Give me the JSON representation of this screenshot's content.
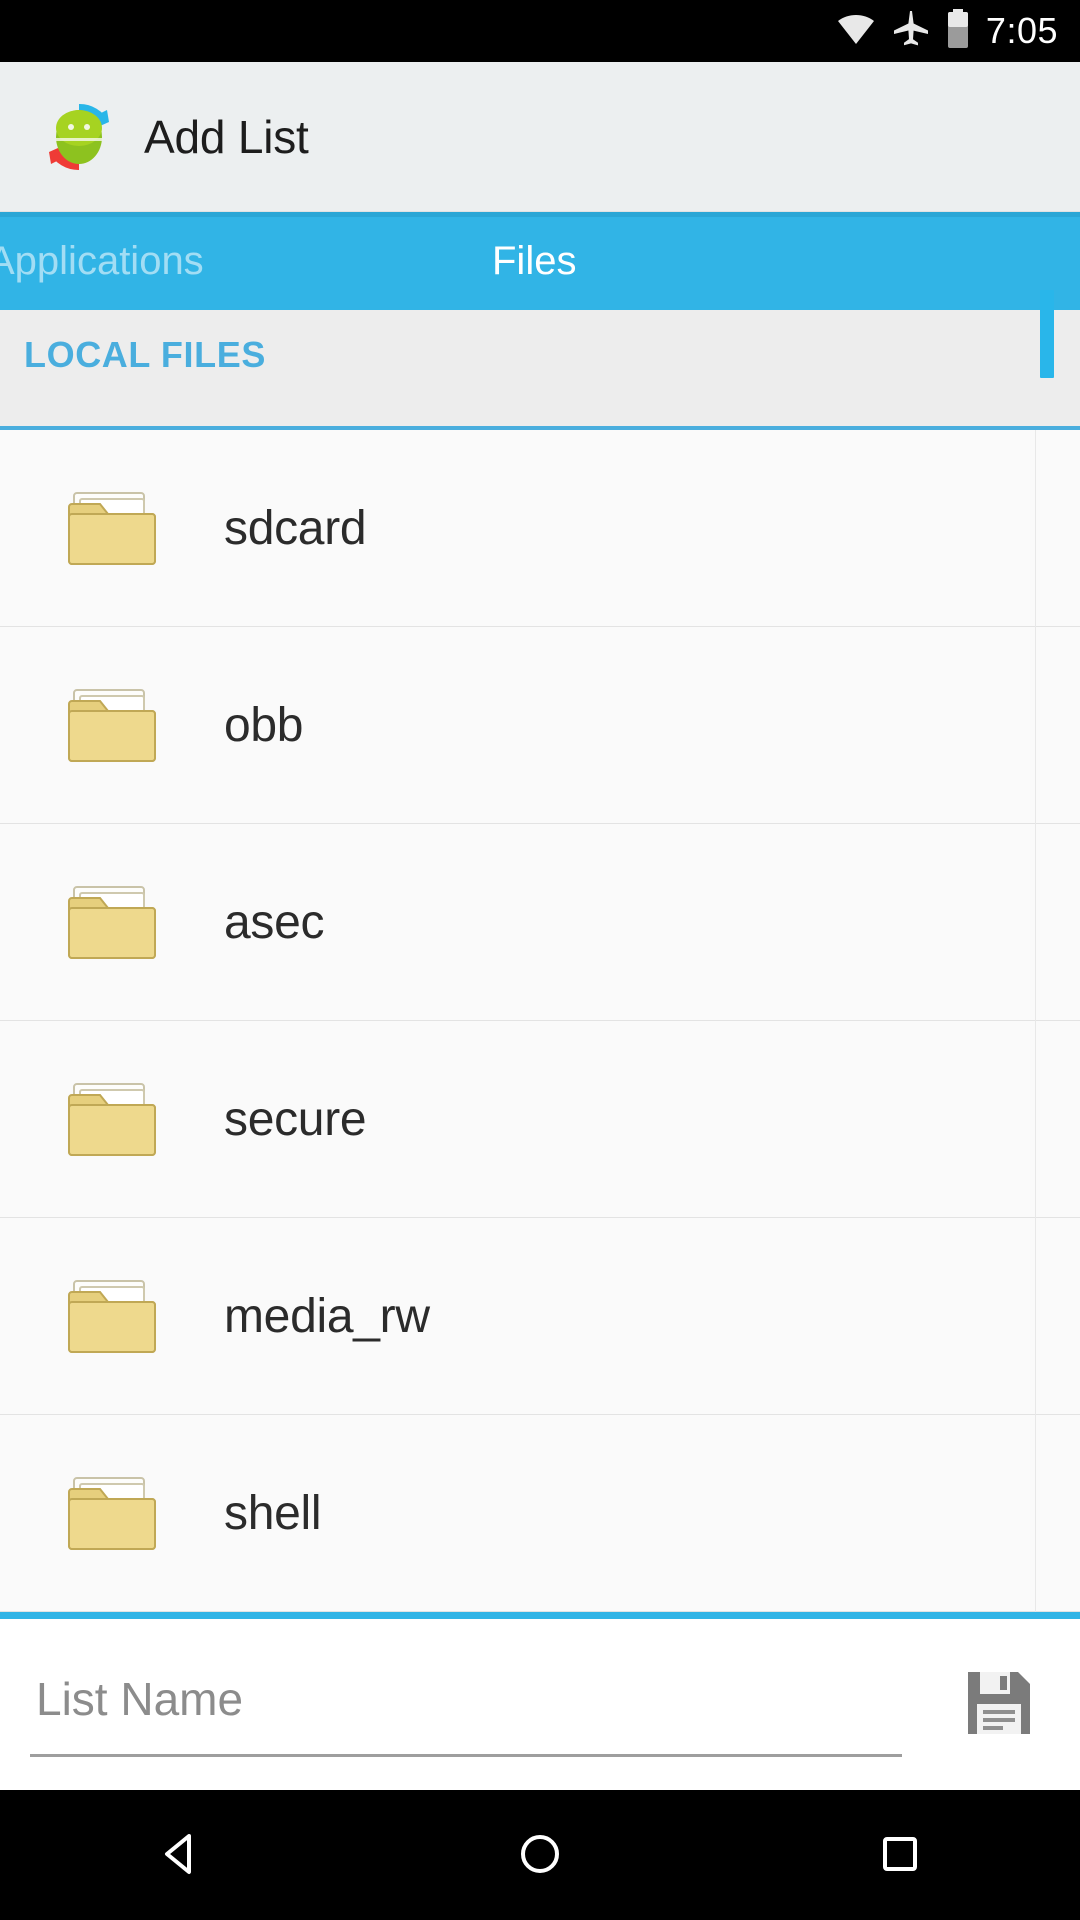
{
  "status_bar": {
    "time": "7:05",
    "icons": [
      "wifi-icon",
      "airplane-mode-icon",
      "battery-icon"
    ]
  },
  "app_bar": {
    "title": "Add List",
    "logo": "android-sync-logo-icon"
  },
  "tabs": [
    {
      "label": "Applications",
      "active": false
    },
    {
      "label": "Files",
      "active": true
    }
  ],
  "section": {
    "header": "LOCAL FILES"
  },
  "files": [
    {
      "name": "sdcard",
      "icon": "folder-icon"
    },
    {
      "name": "obb",
      "icon": "folder-icon"
    },
    {
      "name": "asec",
      "icon": "folder-icon"
    },
    {
      "name": "secure",
      "icon": "folder-icon"
    },
    {
      "name": "media_rw",
      "icon": "folder-icon"
    },
    {
      "name": "shell",
      "icon": "folder-icon"
    }
  ],
  "bottom_bar": {
    "list_name_value": "",
    "list_name_placeholder": "List Name",
    "save_icon": "save-floppy-disk-icon"
  },
  "nav_bar": {
    "back": "back-triangle-icon",
    "home": "home-circle-icon",
    "recents": "recents-square-icon"
  },
  "colors": {
    "accent_blue": "#31b4e6",
    "section_blue": "#4aaede",
    "status_bar": "#000000",
    "app_bar": "#eceff0",
    "folder_gold": "#e3ca76"
  }
}
